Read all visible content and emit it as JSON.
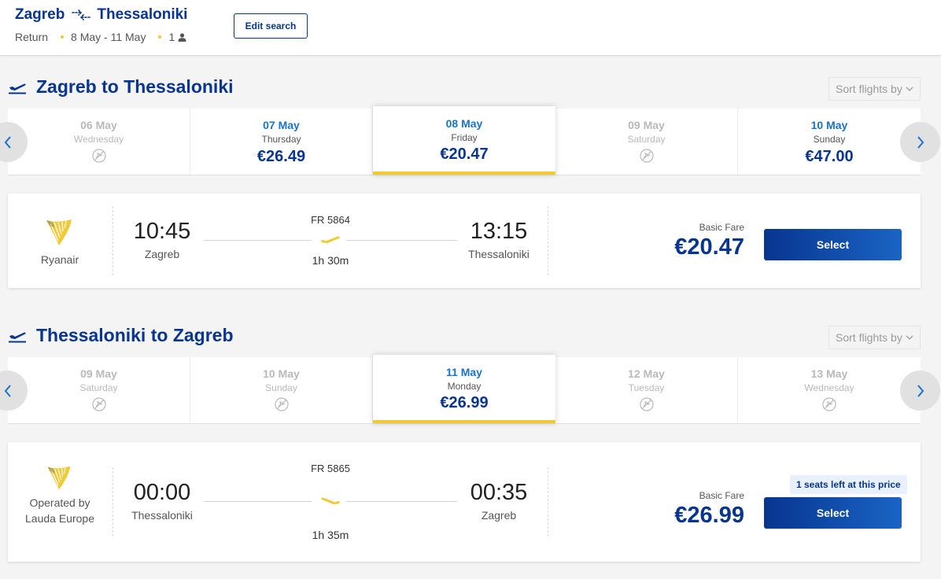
{
  "header": {
    "origin": "Zagreb",
    "destination": "Thessaloniki",
    "trip_type": "Return",
    "dates": "8 May - 11 May",
    "passengers": "1",
    "edit_label": "Edit search"
  },
  "outbound": {
    "title": "Zagreb to Thessaloniki",
    "sort_label": "Sort flights by",
    "dates": [
      {
        "date": "06 May",
        "weekday": "Wednesday",
        "price": "",
        "available": false,
        "selected": false
      },
      {
        "date": "07 May",
        "weekday": "Thursday",
        "price": "€26.49",
        "available": true,
        "selected": false
      },
      {
        "date": "08 May",
        "weekday": "Friday",
        "price": "€20.47",
        "available": true,
        "selected": true
      },
      {
        "date": "09 May",
        "weekday": "Saturday",
        "price": "",
        "available": false,
        "selected": false
      },
      {
        "date": "10 May",
        "weekday": "Sunday",
        "price": "€47.00",
        "available": true,
        "selected": false
      }
    ],
    "flight": {
      "airline": "Ryanair",
      "flight_number": "FR 5864",
      "depart_time": "10:45",
      "depart_city": "Zagreb",
      "arrive_time": "13:15",
      "arrive_city": "Thessaloniki",
      "duration": "1h 30m",
      "fare_label": "Basic Fare",
      "price": "€20.47",
      "select_label": "Select"
    }
  },
  "return": {
    "title": "Thessaloniki to Zagreb",
    "sort_label": "Sort flights by",
    "dates": [
      {
        "date": "09 May",
        "weekday": "Saturday",
        "price": "",
        "available": false,
        "selected": false
      },
      {
        "date": "10 May",
        "weekday": "Sunday",
        "price": "",
        "available": false,
        "selected": false
      },
      {
        "date": "11 May",
        "weekday": "Monday",
        "price": "€26.99",
        "available": true,
        "selected": true
      },
      {
        "date": "12 May",
        "weekday": "Tuesday",
        "price": "",
        "available": false,
        "selected": false
      },
      {
        "date": "13 May",
        "weekday": "Wednesday",
        "price": "",
        "available": false,
        "selected": false
      }
    ],
    "flight": {
      "airline": "Operated by Lauda Europe",
      "flight_number": "FR 5865",
      "depart_time": "00:00",
      "depart_city": "Thessaloniki",
      "arrive_time": "00:35",
      "arrive_city": "Zagreb",
      "duration": "1h 35m",
      "fare_label": "Basic Fare",
      "price": "€26.99",
      "seats_notice": "1 seats left at this price",
      "select_label": "Select"
    }
  },
  "colors": {
    "brand_blue": "#073590",
    "link_blue": "#1a73c8",
    "accent_yellow": "#f1c933"
  },
  "icons": {
    "route": "return-plane-icon",
    "section": "plane-takeoff-icon",
    "no_flight": "no-flight-icon",
    "person": "person-icon",
    "logo": "ryanair-harp-logo"
  }
}
